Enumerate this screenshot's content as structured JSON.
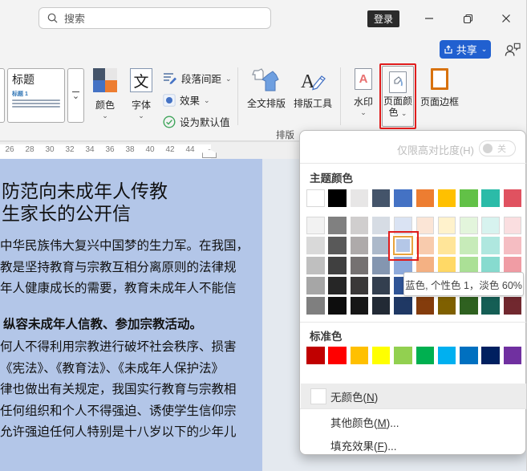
{
  "titlebar": {
    "search_placeholder": "搜索",
    "login_label": "登录"
  },
  "toolbar": {
    "share_label": "共享"
  },
  "ribbon": {
    "style_gallery": {
      "card_title": "标题",
      "card_sub": "标题 1"
    },
    "color_button": "颜色",
    "font_button": "字体",
    "font_glyph": "文",
    "para_spacing": "段落间距",
    "effects": "效果",
    "set_default": "设为默认值",
    "full_layout": "全文排版",
    "layout_tools": "排版工具",
    "watermark": "水印",
    "watermark_glyph": "A",
    "page_color_line1": "页面颜",
    "page_color_line2": "色",
    "page_border": "页面边框",
    "group_label": "排版",
    "color_quad": [
      "#44546A",
      "#E7E6E6",
      "#4472C4",
      "#ED7D31"
    ]
  },
  "ruler": {
    "ticks": [
      "26",
      "28",
      "30",
      "32",
      "34",
      "36",
      "38",
      "40",
      "42",
      "44"
    ]
  },
  "document": {
    "page_background": "#B3C6E8",
    "title_lines": [
      "防范向未成年人传教",
      "生家长的公开信"
    ],
    "paragraph1": [
      "中华民族伟大复兴中国梦的生力军。在我国，",
      "教是坚持教育与宗教互相分离原则的法律规",
      "年人健康成长的需要，教育未成年人不能信"
    ],
    "bold_line": "纵容未成年人信教、参加宗教活动。",
    "paragraph2": [
      "何人不得利用宗教进行破坏社会秩序、损害",
      "《宪法》、《教育法》、《未成年人保护法》",
      "律也做出有关规定，我国实行教育与宗教相",
      "任何组织和个人不得强迫、诱使学生信仰宗",
      "允许强迫任何人特别是十八岁以下的少年儿"
    ]
  },
  "dropdown": {
    "contrast_label": "仅限高对比度(H)",
    "contrast_state": "关",
    "theme_label": "主题颜色",
    "standard_label": "标准色",
    "tooltip": "蓝色, 个性色 1，淡色 60%",
    "selected": {
      "col": 4,
      "row": 1
    },
    "selection_border": "#E8A33D",
    "annotation_color": "#E01C1C",
    "no_color": {
      "pre": "无颜色(",
      "key": "N",
      "post": ")"
    },
    "more_colors": {
      "pre": "其他颜色(",
      "key": "M",
      "post": ")..."
    },
    "fill_effects": {
      "pre": "填充效果(",
      "key": "F",
      "post": ")..."
    },
    "theme_columns": [
      {
        "base": "#FFFFFF",
        "variants": [
          "#F2F2F2",
          "#D9D9D9",
          "#BFBFBF",
          "#A6A6A6",
          "#7F7F7F"
        ]
      },
      {
        "base": "#000000",
        "variants": [
          "#808080",
          "#595959",
          "#404040",
          "#262626",
          "#0D0D0D"
        ]
      },
      {
        "base": "#E7E6E6",
        "variants": [
          "#D0CECE",
          "#AEAAAA",
          "#757171",
          "#3A3838",
          "#161616"
        ]
      },
      {
        "base": "#44546A",
        "variants": [
          "#D6DCE4",
          "#ACB9CA",
          "#8496B0",
          "#333F4F",
          "#222A35"
        ]
      },
      {
        "base": "#4472C4",
        "variants": [
          "#DAE3F3",
          "#B4C7E7",
          "#8EAADB",
          "#2F5496",
          "#1F3864"
        ]
      },
      {
        "base": "#ED7D31",
        "variants": [
          "#FBE5D6",
          "#F8CBAD",
          "#F4B183",
          "#C55A11",
          "#843C0C"
        ]
      },
      {
        "base": "#FFC000",
        "variants": [
          "#FFF2CC",
          "#FFE599",
          "#FFD966",
          "#BF9000",
          "#7F6000"
        ]
      },
      {
        "base": "#62C147",
        "variants": [
          "#E3F5DC",
          "#C7EBB9",
          "#ABE096",
          "#46912F",
          "#2F6120"
        ]
      },
      {
        "base": "#2BBBA8",
        "variants": [
          "#D7F3EF",
          "#AFE7DF",
          "#87DBCF",
          "#1F8C7F",
          "#155E55"
        ]
      },
      {
        "base": "#E05260",
        "variants": [
          "#FADEE0",
          "#F5BDC2",
          "#F09CA4",
          "#A93D47",
          "#71282F"
        ]
      }
    ],
    "standard_colors": [
      "#C00000",
      "#FF0000",
      "#FFC000",
      "#FFFF00",
      "#92D050",
      "#00B050",
      "#00B0F0",
      "#0070C0",
      "#002060",
      "#7030A0"
    ]
  }
}
